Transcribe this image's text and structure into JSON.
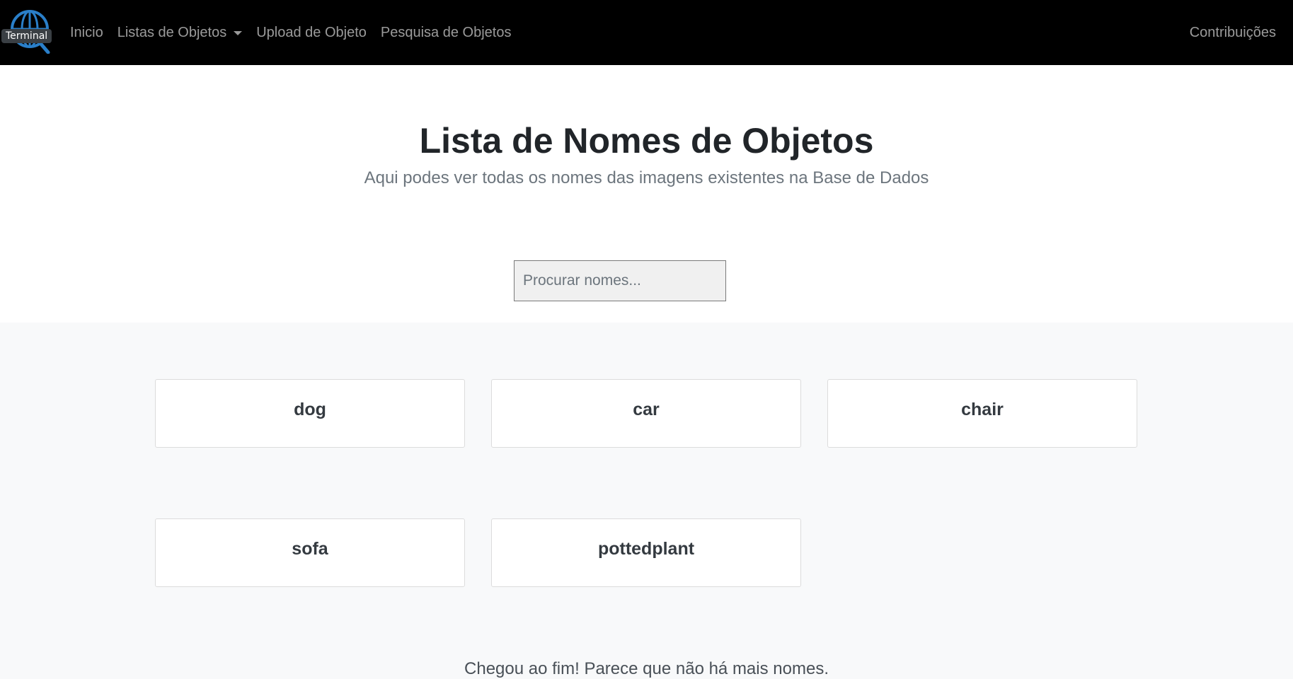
{
  "nav": {
    "brand_label": "Terminal",
    "items": [
      {
        "label": "Inicio"
      },
      {
        "label": "Listas de Objetos"
      },
      {
        "label": "Upload de Objeto"
      },
      {
        "label": "Pesquisa de Objetos"
      }
    ],
    "right_label": "Contribuições",
    "brand_icon": "globe-icon",
    "accent_color": "#2a7fc9"
  },
  "header": {
    "title": "Lista de Nomes de Objetos",
    "subtitle": "Aqui podes ver todas os nomes das imagens existentes na Base de Dados"
  },
  "search": {
    "placeholder": "Procurar nomes...",
    "value": ""
  },
  "cards": [
    {
      "name": "dog"
    },
    {
      "name": "car"
    },
    {
      "name": "chair"
    },
    {
      "name": "sofa"
    },
    {
      "name": "pottedplant"
    }
  ],
  "footer": {
    "end_text": "Chegou ao fim! Parece que não há mais nomes."
  }
}
